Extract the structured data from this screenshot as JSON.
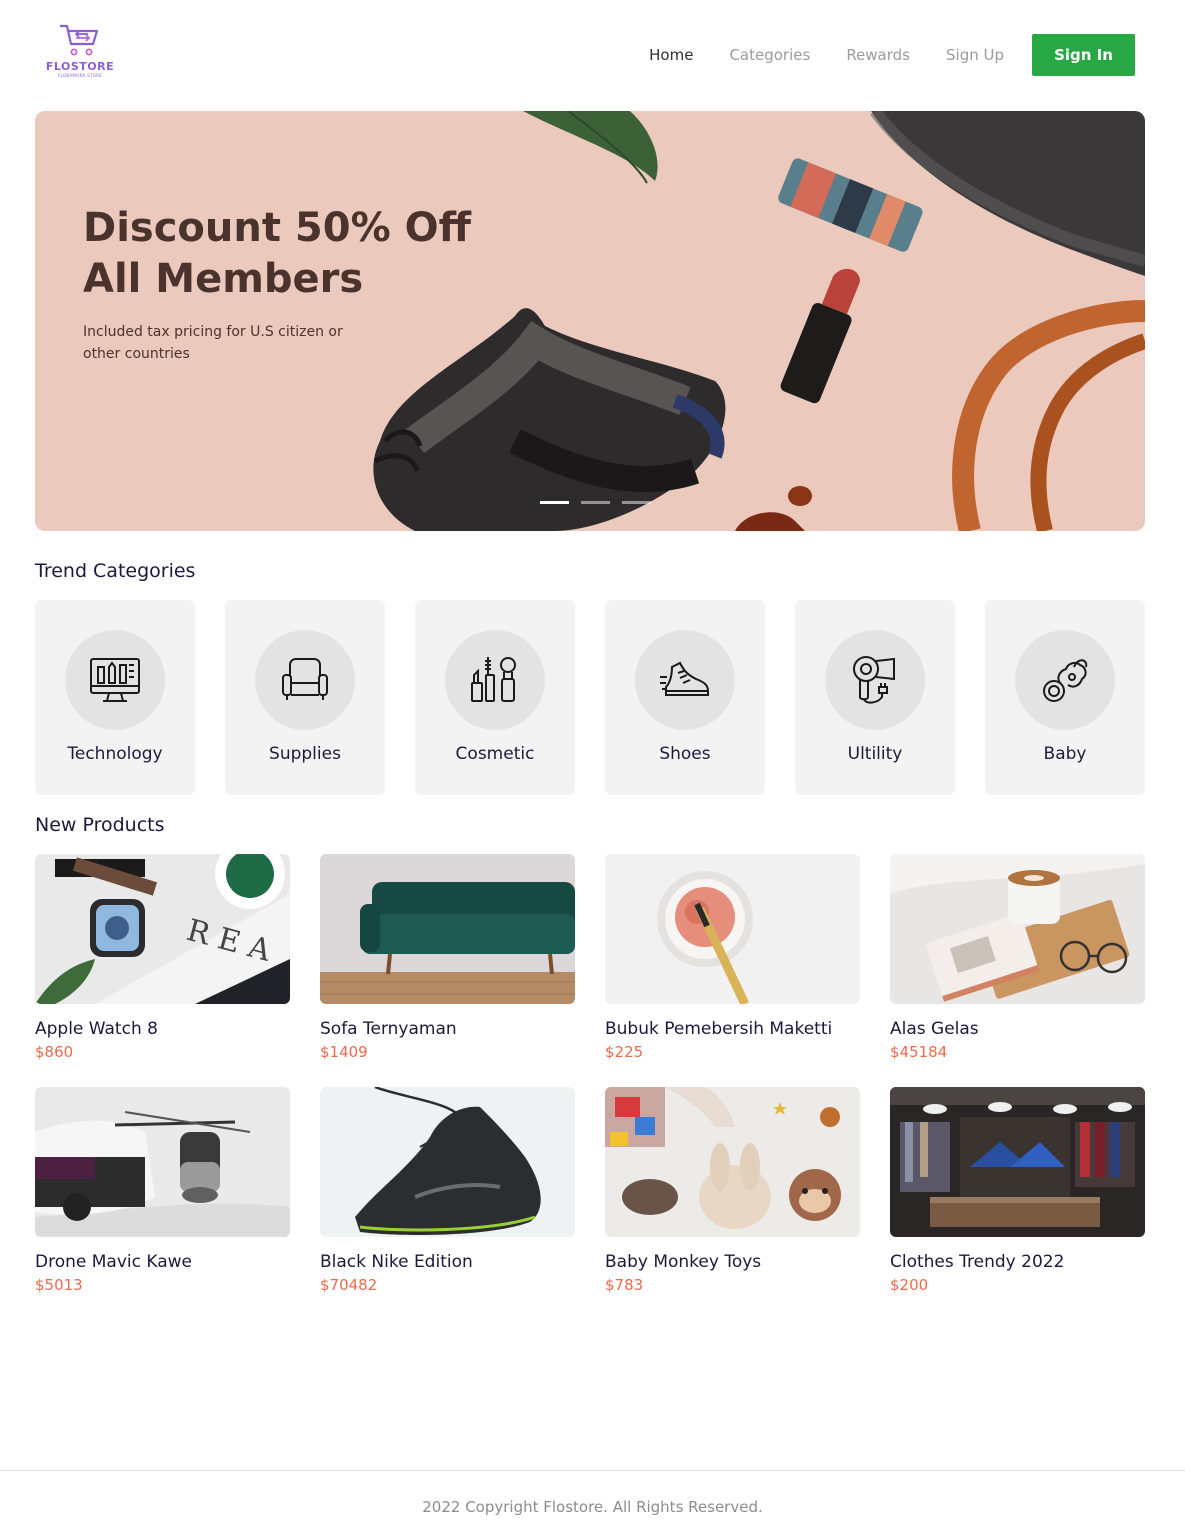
{
  "header": {
    "logo_name": "FLOSTORE",
    "logo_sub": "FLOBAMORA STORE",
    "nav": [
      {
        "label": "Home",
        "active": true
      },
      {
        "label": "Categories",
        "active": false
      },
      {
        "label": "Rewards",
        "active": false
      },
      {
        "label": "Sign Up",
        "active": false
      }
    ],
    "signin_label": "Sign In"
  },
  "hero": {
    "title_line1": "Discount 50% Off",
    "title_line2": "All Members",
    "subtitle": "Included tax pricing for U.S citizen or other countries",
    "slides": 3,
    "active_slide": 1
  },
  "categories": {
    "title": "Trend Categories",
    "items": [
      {
        "label": "Technology",
        "icon": "monitor-icon"
      },
      {
        "label": "Supplies",
        "icon": "armchair-icon"
      },
      {
        "label": "Cosmetic",
        "icon": "cosmetics-icon"
      },
      {
        "label": "Shoes",
        "icon": "sneaker-icon"
      },
      {
        "label": "Ultility",
        "icon": "hair-dryer-icon"
      },
      {
        "label": "Baby",
        "icon": "pacifier-icon"
      }
    ]
  },
  "products": {
    "title": "New Products",
    "items": [
      {
        "name": "Apple Watch 8",
        "price": "$860"
      },
      {
        "name": "Sofa Ternyaman",
        "price": "$1409"
      },
      {
        "name": "Bubuk Pemebersih Maketti",
        "price": "$225"
      },
      {
        "name": "Alas Gelas",
        "price": "$45184"
      },
      {
        "name": "Drone Mavic Kawe",
        "price": "$5013"
      },
      {
        "name": "Black Nike Edition",
        "price": "$70482"
      },
      {
        "name": "Baby Monkey Toys",
        "price": "$783"
      },
      {
        "name": "Clothes Trendy 2022",
        "price": "$200"
      }
    ]
  },
  "footer": {
    "text": "2022 Copyright Flostore. All Rights Reserved."
  },
  "colors": {
    "accent_green": "#28a745",
    "price": "#e96a4c",
    "logo_purple": "#8a5fd8",
    "hero_bg": "#ebc9bd"
  }
}
